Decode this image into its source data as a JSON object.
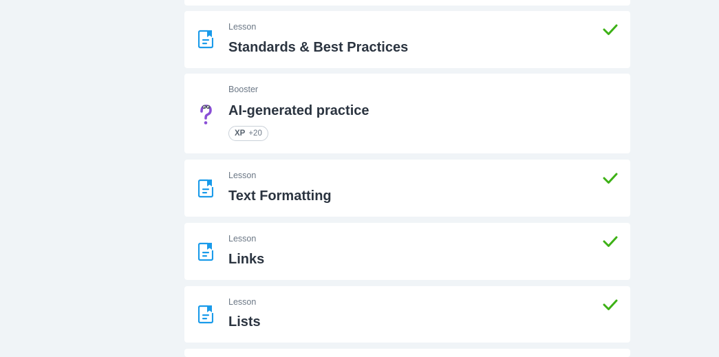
{
  "items": [
    {
      "kind": "Lesson",
      "title": "Standards & Best Practices",
      "completed": true,
      "icon": "lesson-document-icon"
    },
    {
      "kind": "Booster",
      "title": "AI-generated practice",
      "completed": false,
      "icon": "question-mark-character-icon",
      "xp_label": "XP",
      "xp_value": "+20"
    },
    {
      "kind": "Lesson",
      "title": "Text Formatting",
      "completed": true,
      "icon": "lesson-document-icon"
    },
    {
      "kind": "Lesson",
      "title": "Links",
      "completed": true,
      "icon": "lesson-document-icon"
    },
    {
      "kind": "Lesson",
      "title": "Lists",
      "completed": true,
      "icon": "lesson-document-icon"
    }
  ],
  "colors": {
    "page_bg": "#f0f4f7",
    "card_bg": "#ffffff",
    "lesson_icon": "#1a9bea",
    "booster_icon": "#8a4fd6",
    "check": "#3db116",
    "title_text": "#2b3440",
    "kind_text": "#6b7785"
  }
}
